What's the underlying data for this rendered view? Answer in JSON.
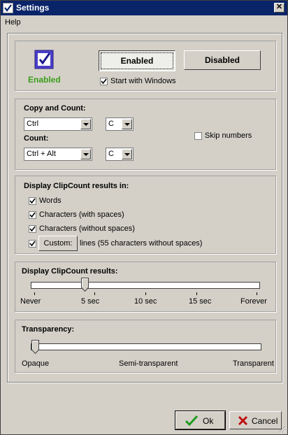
{
  "window": {
    "title": "Settings",
    "close_glyph": "✕"
  },
  "menu": {
    "items": [
      "Help"
    ]
  },
  "status": {
    "state_label": "Enabled",
    "enabled_button": "Enabled",
    "disabled_button": "Disabled",
    "start_with_windows": {
      "label": "Start with Windows",
      "checked": true
    },
    "icon": "clipboard-check-icon",
    "state_color": "#3a9e1a"
  },
  "copy_count": {
    "title": "Copy and Count:",
    "modifier": "Ctrl",
    "key": "C",
    "count_title": "Count:",
    "count_modifier": "Ctrl + Alt",
    "count_key": "C",
    "skip_numbers": {
      "label": "Skip numbers",
      "checked": false
    }
  },
  "display_in": {
    "title": "Display ClipCount results in:",
    "options": [
      {
        "label": "Words",
        "checked": true
      },
      {
        "label": "Characters (with spaces)",
        "checked": true
      },
      {
        "label": "Characters (without spaces)",
        "checked": true
      }
    ],
    "custom": {
      "checked": true,
      "button": "Custom:",
      "label": "lines (55 characters without spaces)"
    }
  },
  "duration": {
    "title": "Display ClipCount results:",
    "ticks": [
      "Never",
      "5 sec",
      "10 sec",
      "15 sec",
      "Forever"
    ],
    "value_fraction": 0.16
  },
  "transparency": {
    "title": "Transparency:",
    "labels": [
      "Opaque",
      "Semi-transparent",
      "Transparent"
    ],
    "value_fraction": 0.0
  },
  "footer": {
    "ok": "Ok",
    "cancel": "Cancel",
    "ok_icon": "checkmark-icon",
    "cancel_icon": "x-icon"
  }
}
